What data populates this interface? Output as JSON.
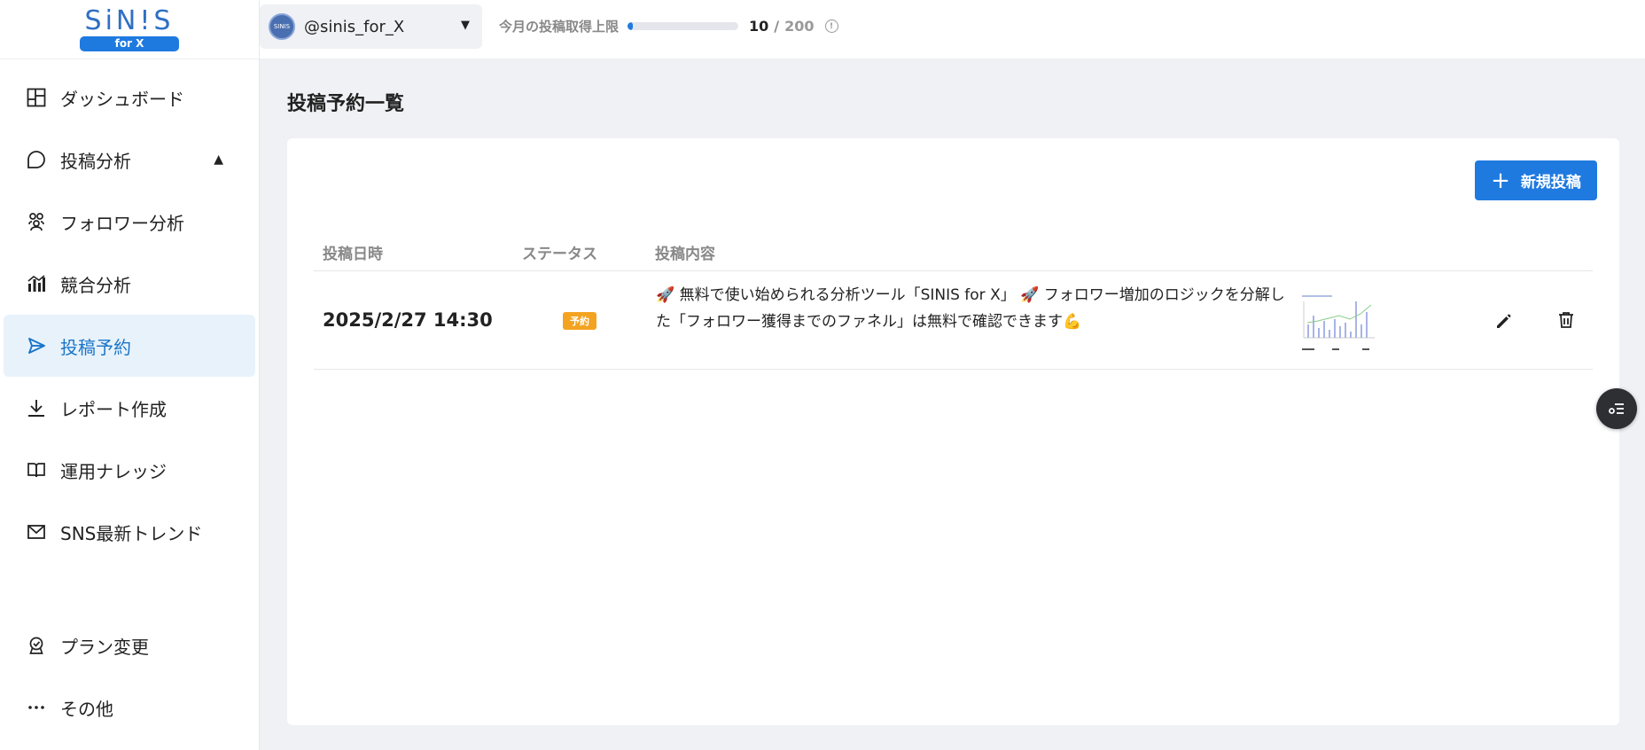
{
  "logo": {
    "text": "SiN!S",
    "badge": "for X"
  },
  "sidebar": {
    "items": [
      {
        "label": "ダッシュボード",
        "icon": "dashboard-icon"
      },
      {
        "label": "投稿分析",
        "icon": "speech-bubble-icon",
        "caret": "▲"
      },
      {
        "label": "フォロワー分析",
        "icon": "people-icon"
      },
      {
        "label": "競合分析",
        "icon": "bar-chart-icon"
      },
      {
        "label": "投稿予約",
        "icon": "send-icon",
        "active": true
      },
      {
        "label": "レポート作成",
        "icon": "download-icon"
      },
      {
        "label": "運用ナレッジ",
        "icon": "book-icon"
      },
      {
        "label": "SNS最新トレンド",
        "icon": "mail-icon"
      }
    ],
    "bottom_items": [
      {
        "label": "プラン変更",
        "icon": "badge-icon"
      },
      {
        "label": "その他",
        "icon": "more-icon"
      }
    ]
  },
  "topbar": {
    "account": "@sinis_for_X",
    "avatar_text": "SINIS",
    "quota_label": "今月の投稿取得上限",
    "quota_used": "10",
    "quota_sep": "/",
    "quota_total": "200",
    "quota_fraction": 0.05
  },
  "main": {
    "title": "投稿予約一覧",
    "new_post_label": "新規投稿",
    "columns": [
      "投稿日時",
      "ステータス",
      "投稿内容"
    ],
    "rows": [
      {
        "datetime": "2025/2/27 14:30",
        "status": "予約",
        "content": "🚀 無料で使い始められる分析ツール「SINIS for X」 🚀 フォロワー増加のロジックを分解した「フォロワー獲得までのファネル」は無料で確認できます💪"
      }
    ]
  },
  "colors": {
    "accent": "#1f7ae0",
    "active_bg": "#e8f2fb",
    "status_badge": "#f4a321"
  }
}
